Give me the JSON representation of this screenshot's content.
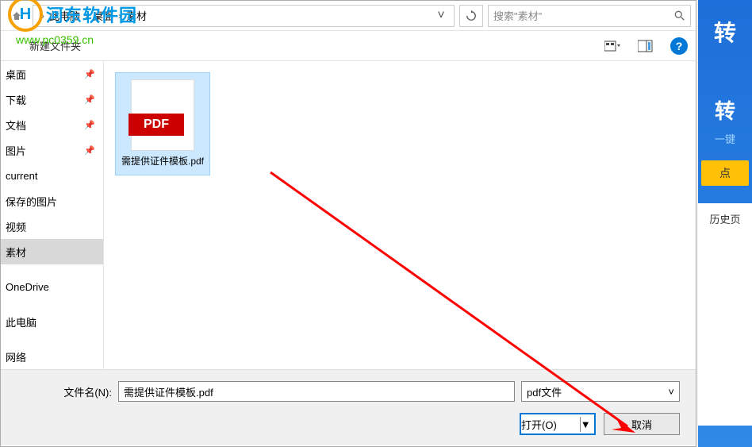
{
  "breadcrumb": {
    "item1": "此电脑",
    "item2": "桌面",
    "item3": "素材"
  },
  "search": {
    "placeholder": "搜索\"素材\""
  },
  "toolbar": {
    "newfolder": "新建文件夹"
  },
  "sidebar": {
    "items": [
      {
        "label": "桌面",
        "pinned": true
      },
      {
        "label": "下载",
        "pinned": true
      },
      {
        "label": "文档",
        "pinned": true
      },
      {
        "label": "图片",
        "pinned": true
      },
      {
        "label": "current",
        "pinned": false
      },
      {
        "label": "保存的图片",
        "pinned": false
      },
      {
        "label": "视频",
        "pinned": false
      },
      {
        "label": "素材",
        "pinned": false,
        "active": true
      },
      {
        "label": "OneDrive",
        "pinned": false
      },
      {
        "label": "此电脑",
        "pinned": false
      },
      {
        "label": "网络",
        "pinned": false
      }
    ]
  },
  "file": {
    "name": "需提供证件模板.pdf"
  },
  "footer": {
    "label": "文件名(N):",
    "value": "需提供证件模板.pdf",
    "filter": "pdf文件",
    "open": "打开(O)",
    "cancel": "取消"
  },
  "watermark": {
    "brand": "河东软件园",
    "url": "www.pc0359.cn"
  },
  "panel": {
    "t1": "转",
    "t2": "转",
    "sub": "一键",
    "btn": "点",
    "hist": "历史页"
  }
}
